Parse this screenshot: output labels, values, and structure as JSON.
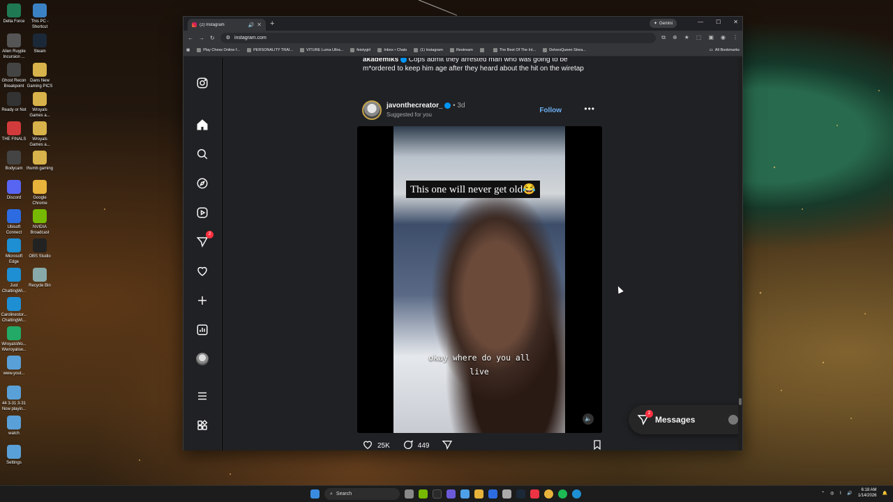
{
  "desktop": {
    "icons": [
      {
        "label": "Delta Force",
        "color": "#1f7a54"
      },
      {
        "label": "This PC - Shortcut",
        "color": "#3b82c4"
      },
      {
        "label": "Allen Ruyple Incursion ...",
        "color": "#555"
      },
      {
        "label": "Steam",
        "color": "#1b2838"
      },
      {
        "label": "Ghost Recon Breakpoint",
        "color": "#444"
      },
      {
        "label": "Dans New Gaming PICS",
        "color": "#d8b24a"
      },
      {
        "label": "Ready or Not",
        "color": "#333"
      },
      {
        "label": "Wroyals Games a...",
        "color": "#d8b24a"
      },
      {
        "label": "THE FINALS",
        "color": "#d23b3b"
      },
      {
        "label": "Wroyals Games a...",
        "color": "#d8b24a"
      },
      {
        "label": "Bodycam",
        "color": "#444"
      },
      {
        "label": "thumb gaming",
        "color": "#d8b24a"
      },
      {
        "label": "Discord",
        "color": "#5865f2"
      },
      {
        "label": "Google Chrome",
        "color": "#e8b33b"
      },
      {
        "label": "Ubisoft Connect",
        "color": "#2d6be0"
      },
      {
        "label": "NVIDIA Broadcast",
        "color": "#76b900"
      },
      {
        "label": "Microsoft Edge",
        "color": "#1f8fd3"
      },
      {
        "label": "OBS Studio",
        "color": "#222"
      },
      {
        "label": "Just ChattingWi...",
        "color": "#1f8fd3"
      },
      {
        "label": "Recycle Bin",
        "color": "#8aa"
      },
      {
        "label": "Carolinestor... ChattingWi...",
        "color": "#1f8fd3"
      },
      {
        "label": "WroyalsWo... Wwroyalsw...",
        "color": "#2a6"
      },
      {
        "label": "www.yout...",
        "color": "#5aa0d8"
      },
      {
        "label": "44 3-31 3-31 Now playin...",
        "color": "#5aa0d8"
      },
      {
        "label": "watch",
        "color": "#5aa0d8"
      },
      {
        "label": "Settings",
        "color": "#5aa0d8"
      }
    ]
  },
  "browser": {
    "tab_title": "(2) Instagram",
    "new_tab": "+",
    "gemini_label": "Gemini",
    "url": "instagram.com",
    "bookmarks": [
      "Play Chess Online f...",
      "PERSONALITY TRAI...",
      "VITURE Luma Ultra...",
      "feistygirl",
      "Inbox • Chats",
      "(1) Instagram",
      "Restream",
      "",
      "The Best Of The Int...",
      "DelvesQueen Strea..."
    ],
    "all_bookmarks": "All Bookmarks"
  },
  "instagram": {
    "nav_badge": "2",
    "caption_user": "akademiks",
    "caption_text": "Cops admit they arrested man who was going to be m*ordered to keep him age after they heard about the hit on the wiretap",
    "post": {
      "username": "javonthecreator_",
      "time": " • 3d",
      "subtitle": "Suggested for you",
      "follow": "Follow",
      "more": "•••",
      "overlay_top": "This one will never get old😂",
      "overlay_sub_line1": "okay where do you all",
      "overlay_sub_line2": "live",
      "likes": "25K",
      "comments": "449"
    },
    "messages": {
      "label": "Messages",
      "badge": "2"
    }
  },
  "taskbar": {
    "search": "Search",
    "time": "6:18 AM",
    "date": "1/14/2026"
  }
}
